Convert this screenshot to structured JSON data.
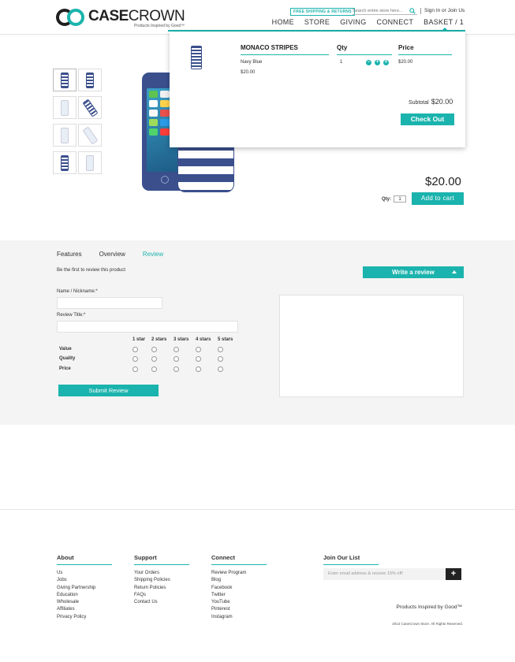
{
  "brand": {
    "word_bold": "CASE",
    "word_light": "CROWN",
    "tagline": "Products Inspired by Good™"
  },
  "topbar": {
    "shipping_badge": "FREE SHIPPING & RETURNS",
    "search_placeholder": "Search entire store here...",
    "account_link": "Sign In or Join Us"
  },
  "nav": {
    "items": [
      "HOME",
      "STORE",
      "GIVING",
      "CONNECT",
      "BASKET / 1"
    ]
  },
  "product": {
    "price": "$20.00",
    "qty_label": "Qty:",
    "qty_value": "1",
    "add_to_cart": "Add to cart"
  },
  "basket": {
    "col_product": "MONACO STRIPES",
    "col_qty": "Qty",
    "col_price": "Price",
    "variant": "Navy Blue",
    "unit_price": "$20.00",
    "qty": "1",
    "line_price": "$20.00",
    "subtotal_label": "Subtotal",
    "subtotal_value": "$20.00",
    "checkout": "Check Out"
  },
  "review": {
    "tabs": [
      "Features",
      "Overview",
      "Review"
    ],
    "active_tab": "Review",
    "empty_text": "Be the first to review this product",
    "write_review": "Write a review",
    "name_label": "Name / Nickname:*",
    "title_label": "Review Title:*",
    "rating_headers": [
      "1 star",
      "2 stars",
      "3 stars",
      "4 stars",
      "5 stars"
    ],
    "rating_rows": [
      "Value",
      "Quality",
      "Price"
    ],
    "submit": "Submit Review"
  },
  "footer": {
    "about": {
      "title": "About",
      "links": [
        "Us",
        "Jobs",
        "Giving Partnership",
        "Education",
        "Wholesale",
        "Affiliates",
        "Privacy Policy"
      ]
    },
    "support": {
      "title": "Support",
      "links": [
        "Your Orders",
        "Shipping Policies",
        "Return Policies",
        "FAQs",
        "Contact Us"
      ]
    },
    "connect": {
      "title": "Connect",
      "links": [
        "Review Program",
        "Blog",
        "Facebook",
        "Twitter",
        "YouTube",
        "Pinterest",
        "Instagram"
      ]
    },
    "join": {
      "title": "Join Our List",
      "placeholder": "Enter email address & receive 15% off!",
      "button": "+"
    },
    "tagline": "Products Inspired by Good™",
    "copyright": "2013 CaseCrown Store. All Rights Reserved."
  },
  "colors": {
    "accent": "#1bb3ad",
    "stripe_navy": "#3a4f8c"
  },
  "icons": [
    "search-icon",
    "minus-icon",
    "plus-icon",
    "remove-icon",
    "caret-up-icon",
    "plus-icon"
  ]
}
